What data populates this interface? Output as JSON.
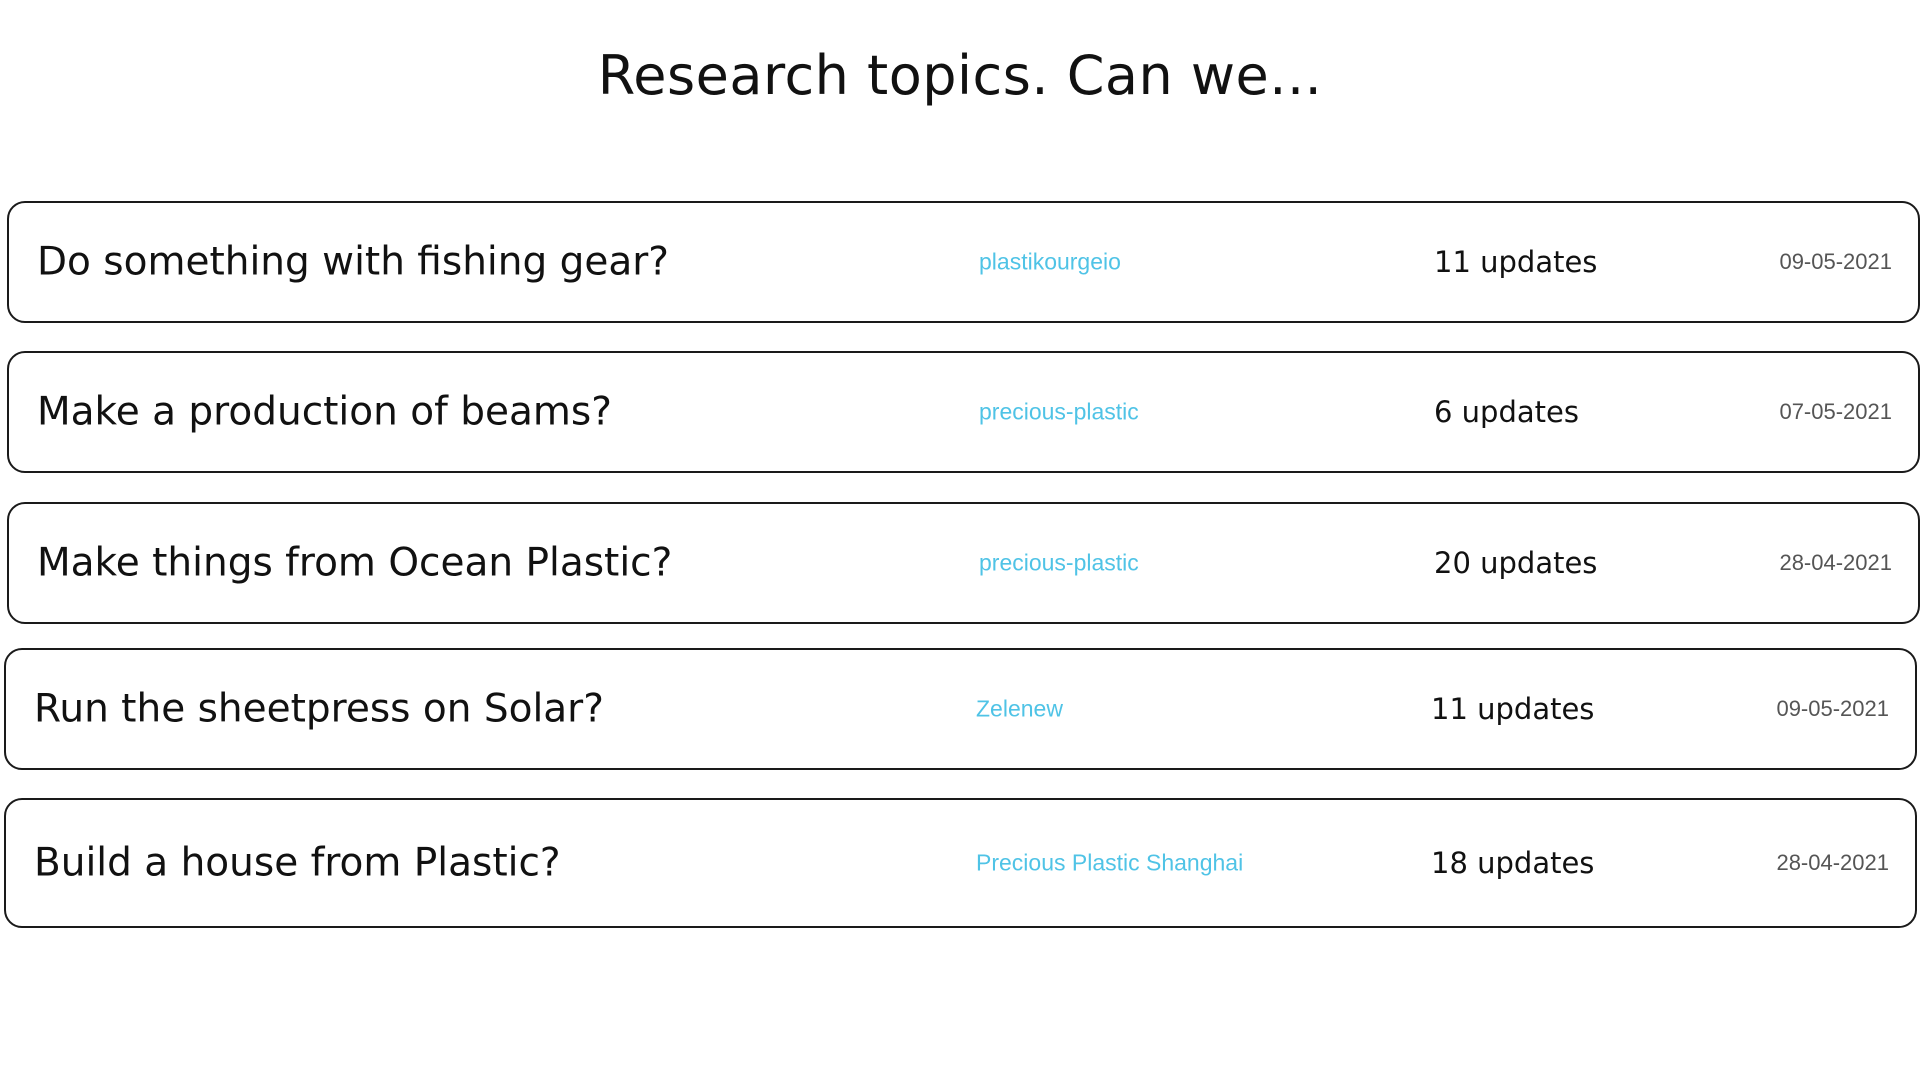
{
  "page": {
    "title": "Research topics. Can we..."
  },
  "colors": {
    "author_link": "#4fc3e6",
    "border": "#1a1a1a",
    "text": "#111111",
    "date": "#555555"
  },
  "topics": [
    {
      "title": "Do something with fishing gear?",
      "author": "plastikourgeio",
      "updates": "11 updates",
      "date": "09-05-2021"
    },
    {
      "title": "Make a production of beams?",
      "author": "precious-plastic",
      "updates": "6 updates",
      "date": "07-05-2021"
    },
    {
      "title": "Make things from Ocean Plastic?",
      "author": "precious-plastic",
      "updates": "20 updates",
      "date": "28-04-2021"
    },
    {
      "title": "Run the sheetpress on Solar?",
      "author": "Zelenew",
      "updates": "11 updates",
      "date": "09-05-2021"
    },
    {
      "title": "Build a house from Plastic?",
      "author": "Precious Plastic Shanghai",
      "updates": "18 updates",
      "date": "28-04-2021"
    }
  ]
}
